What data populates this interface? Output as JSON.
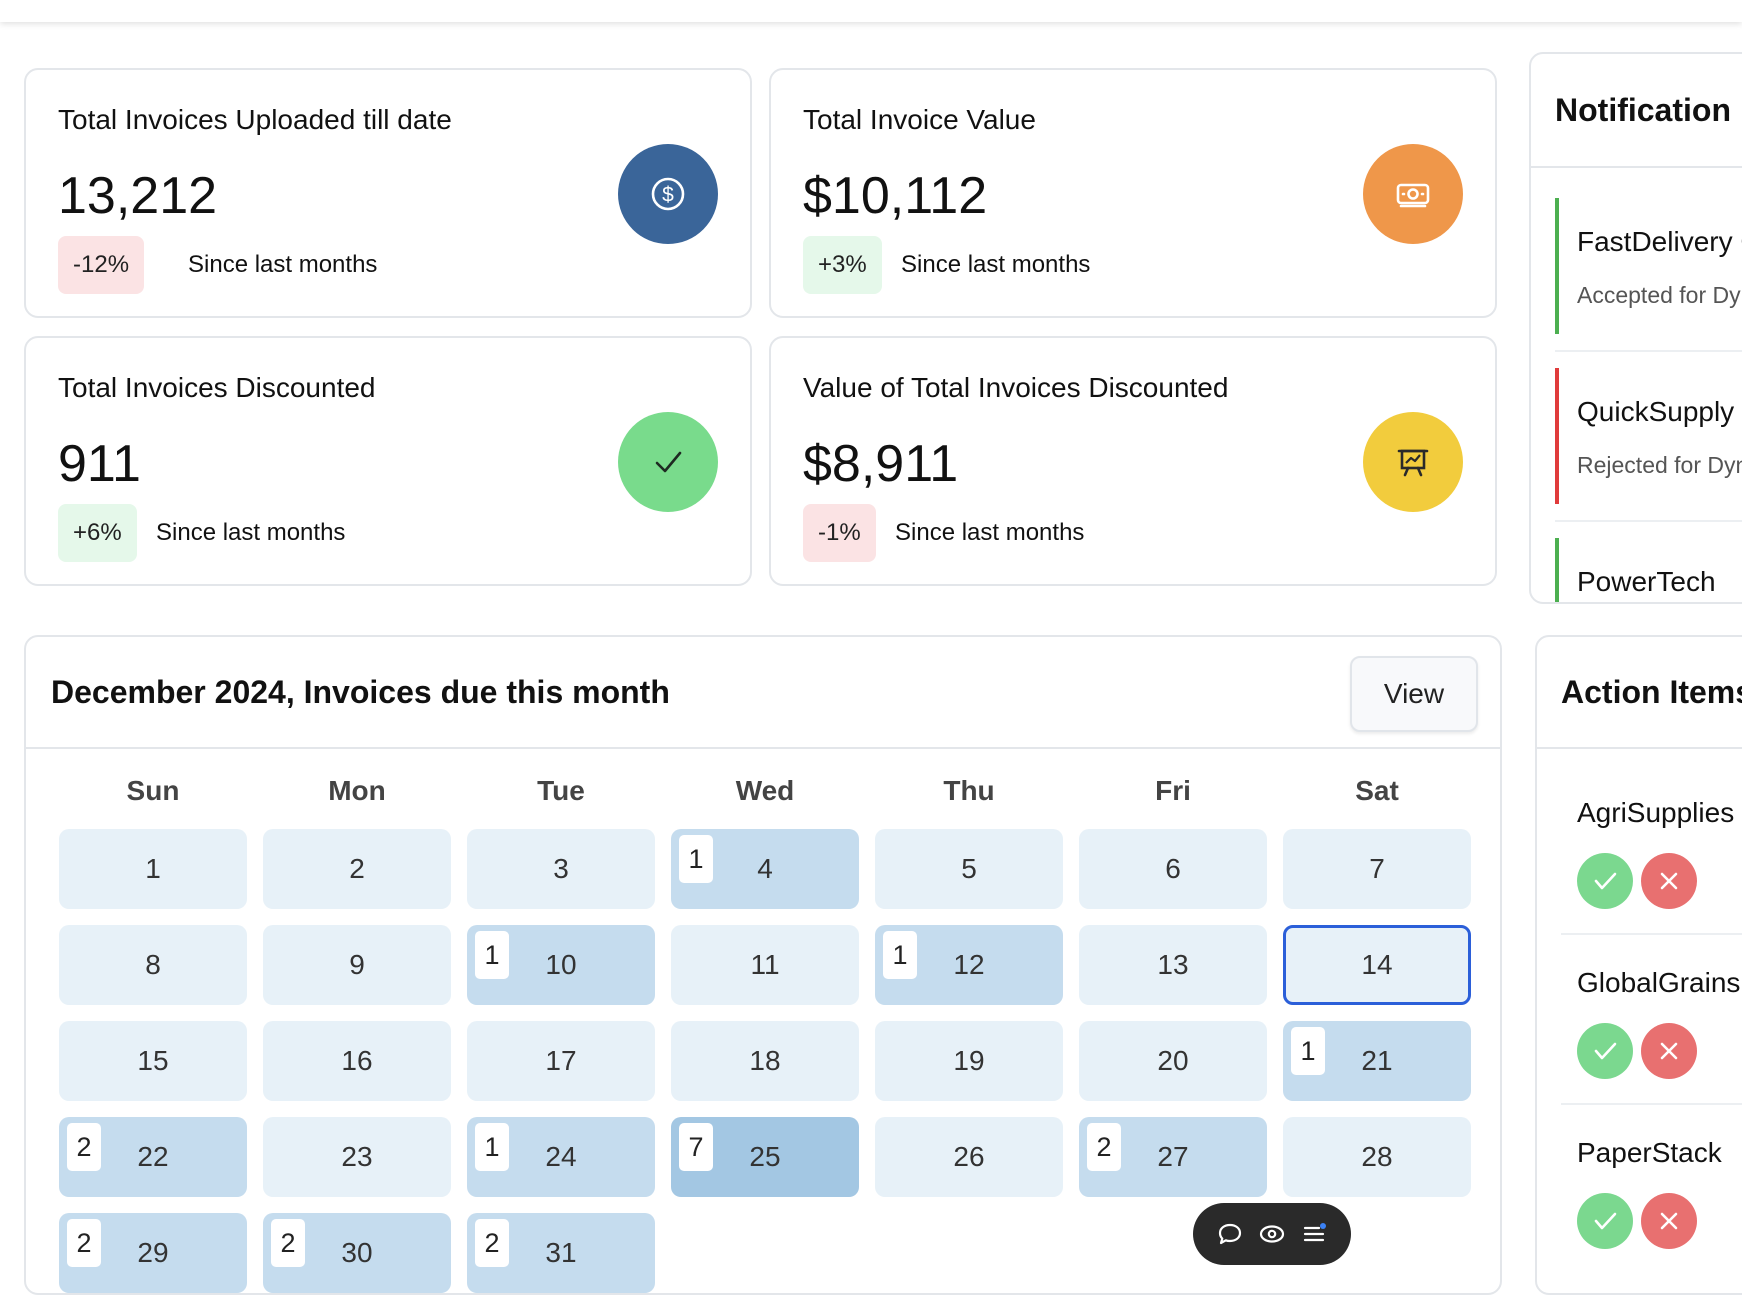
{
  "stats": [
    {
      "title": "Total Invoices Uploaded till date",
      "value": "13,212",
      "change": "-12%",
      "since": "Since last months",
      "icon": "dollar-coin-icon",
      "color": "#3a6599"
    },
    {
      "title": "Total Invoice Value",
      "value": "$10,112",
      "change": "+3%",
      "since": "Since last months",
      "icon": "banknote-icon",
      "color": "#ef974a"
    },
    {
      "title": "Total Invoices Discounted",
      "value": "911",
      "change": "+6%",
      "since": "Since last months",
      "icon": "checkmark-icon",
      "color": "#79db8c"
    },
    {
      "title": "Value of Total Invoices Discounted",
      "value": "$8,911",
      "change": "-1%",
      "since": "Since last months",
      "icon": "presentation-chart-icon",
      "color": "#f2cc3d"
    }
  ],
  "notifications": {
    "title": "Notification",
    "items": [
      {
        "title": "FastDelivery C",
        "subtitle": "Accepted for Dy",
        "status": "accepted"
      },
      {
        "title": "QuickSupply",
        "subtitle": "Rejected for Dyn",
        "status": "rejected"
      },
      {
        "title": "PowerTech",
        "subtitle": "",
        "status": "accepted"
      }
    ]
  },
  "calendar": {
    "title": "December 2024, Invoices due this month",
    "view_label": "View",
    "weekdays": [
      "Sun",
      "Mon",
      "Tue",
      "Wed",
      "Thu",
      "Fri",
      "Sat"
    ],
    "today": 14,
    "days": [
      {
        "day": "1",
        "count": ""
      },
      {
        "day": "2",
        "count": ""
      },
      {
        "day": "3",
        "count": ""
      },
      {
        "day": "4",
        "count": "1"
      },
      {
        "day": "5",
        "count": ""
      },
      {
        "day": "6",
        "count": ""
      },
      {
        "day": "7",
        "count": ""
      },
      {
        "day": "8",
        "count": ""
      },
      {
        "day": "9",
        "count": ""
      },
      {
        "day": "10",
        "count": "1"
      },
      {
        "day": "11",
        "count": ""
      },
      {
        "day": "12",
        "count": "1"
      },
      {
        "day": "13",
        "count": ""
      },
      {
        "day": "14",
        "count": ""
      },
      {
        "day": "15",
        "count": ""
      },
      {
        "day": "16",
        "count": ""
      },
      {
        "day": "17",
        "count": ""
      },
      {
        "day": "18",
        "count": ""
      },
      {
        "day": "19",
        "count": ""
      },
      {
        "day": "20",
        "count": ""
      },
      {
        "day": "21",
        "count": "1"
      },
      {
        "day": "22",
        "count": "2"
      },
      {
        "day": "23",
        "count": ""
      },
      {
        "day": "24",
        "count": "1"
      },
      {
        "day": "25",
        "count": "7"
      },
      {
        "day": "26",
        "count": ""
      },
      {
        "day": "27",
        "count": "2"
      },
      {
        "day": "28",
        "count": ""
      },
      {
        "day": "29",
        "count": "2"
      },
      {
        "day": "30",
        "count": "2"
      },
      {
        "day": "31",
        "count": "2"
      }
    ]
  },
  "action_items": {
    "title": "Action Items",
    "items": [
      {
        "name": "AgriSupplies"
      },
      {
        "name": "GlobalGrains"
      },
      {
        "name": "PaperStack"
      }
    ]
  },
  "toolbar": {
    "icons": [
      "chat-bubble-icon",
      "eye-icon",
      "menu-list-icon"
    ]
  }
}
